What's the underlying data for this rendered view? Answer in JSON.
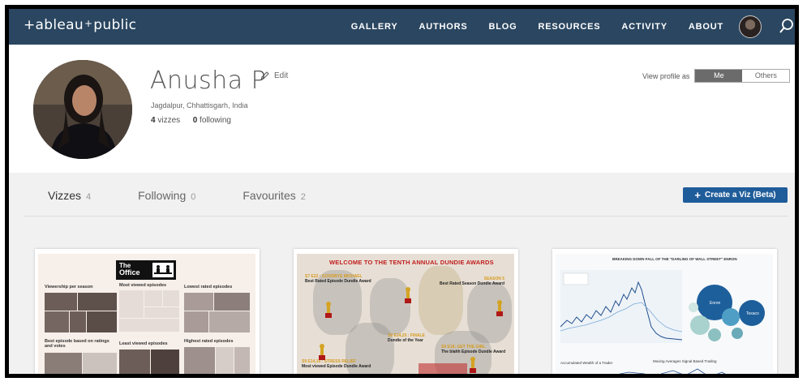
{
  "nav": {
    "logo": "+ableau+public",
    "logo_parts": [
      "+ableau",
      "+",
      "public"
    ],
    "links": [
      "GALLERY",
      "AUTHORS",
      "BLOG",
      "RESOURCES",
      "ACTIVITY",
      "ABOUT"
    ]
  },
  "profile": {
    "name": "Anusha P",
    "edit_label": "Edit",
    "location": "Jagdalpur, Chhattisgarh, India",
    "vizzes_count": "4",
    "vizzes_label": "vizzes",
    "following_count": "0",
    "following_label": "following",
    "view_as_label": "View profile as",
    "view_as_options": [
      "Me",
      "Others"
    ],
    "view_as_selected": "Me"
  },
  "tabs": [
    {
      "label": "Vizzes",
      "count": "4"
    },
    {
      "label": "Following",
      "count": "0"
    },
    {
      "label": "Favourites",
      "count": "2"
    }
  ],
  "create_button": "Create a Viz (Beta)",
  "cards": {
    "office": {
      "logo_line1": "The",
      "logo_line2": "Office",
      "labels": [
        "Viewership per season",
        "Most viewed episodes",
        "Lowest rated episodes",
        "Best episode based on ratings and votes",
        "Least viewed episodes",
        "Highest rated episodes"
      ]
    },
    "dundie": {
      "title": "WELCOME TO THE TENTH ANNUAL DUNDIE AWARDS",
      "awards": [
        {
          "code": "S7 E22 : GOODBYE MICHAEL",
          "name": "Best Rated Episode Dundie Award"
        },
        {
          "code": "SEASON 5",
          "name": "Best Rated Season Dundie Award"
        },
        {
          "code": "S9 E24,25 : FINALE",
          "name": "Dundie of the Year"
        },
        {
          "code": "S9 E14,15 : STRESS RELIEF",
          "name": "Most viewed Episode Dundie Award"
        },
        {
          "code": "S9 E18: GET THE GIRL",
          "name": "The blahh Episode Dundie Award"
        }
      ]
    },
    "enron": {
      "title": "BREAKING DOWN FALL OF THE \"DARLING OF WALL STREET\" ENRON",
      "bubbles": [
        "Enron",
        "Texaco"
      ],
      "bottom_labels": [
        "Accumulated Wealth of a Trader",
        "Moving Averages Signal Based Trading"
      ]
    }
  },
  "colors": {
    "nav_bg": "#2a4660",
    "button_bg": "#1f5c9a",
    "content_bg": "#f1f1f1"
  }
}
